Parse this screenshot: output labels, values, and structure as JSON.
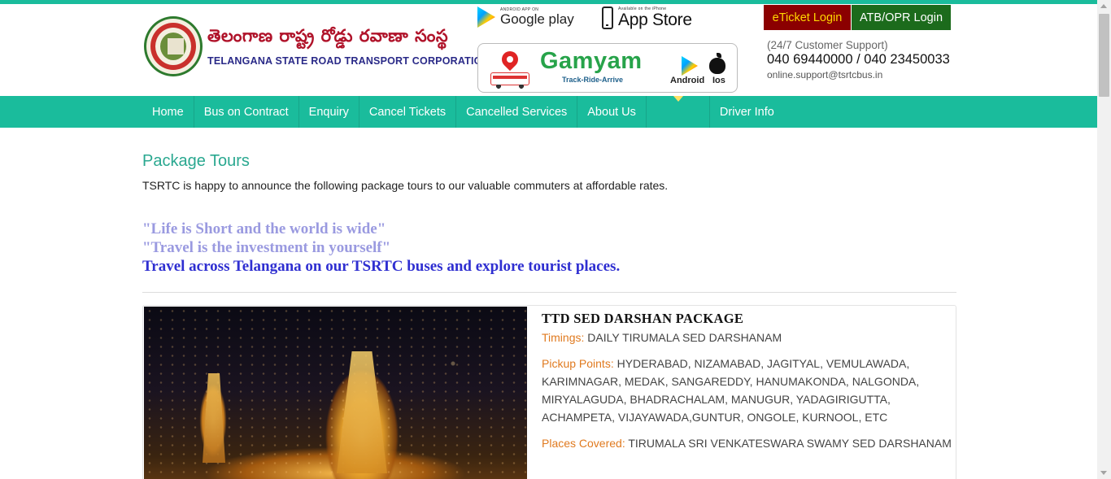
{
  "header": {
    "org_telugu": "తెలంగాణ రాష్ట్ర రోడ్డు రవాణా సంస్థ",
    "org_english": "TELANGANA STATE ROAD TRANSPORT CORPORATION",
    "google_play_small": "ANDROID APP ON",
    "google_play_label": "Google play",
    "app_store_small": "Available on the iPhone",
    "app_store_label": "App Store",
    "gamyam": {
      "title": "Gamyam",
      "tagline": "Track-Ride-Arrive",
      "android_label": "Android",
      "ios_label": "Ios"
    },
    "eticket_label": "eTicket Login",
    "atb_label": "ATB/OPR Login",
    "support": {
      "label": "(24/7 Customer Support)",
      "phones": "040 69440000 / 040 23450033",
      "email": "online.support@tsrtcbus.in"
    }
  },
  "nav": {
    "items": [
      {
        "label": "Home"
      },
      {
        "label": "Bus on Contract"
      },
      {
        "label": "Enquiry"
      },
      {
        "label": "Cancel Tickets"
      },
      {
        "label": "Cancelled Services"
      },
      {
        "label": "About Us"
      },
      {
        "label": "Driver Info"
      }
    ]
  },
  "main": {
    "title": "Package Tours",
    "intro": "TSRTC is happy to announce the following package tours to our valuable commuters at affordable rates.",
    "quote1": "\"Life is Short and the world is wide\"",
    "quote2": "\"Travel is the investment in yourself\"",
    "quote3": "Travel across Telangana on our TSRTC buses and explore tourist places."
  },
  "package": {
    "title": "TTD SED DARSHAN PACKAGE",
    "timings_label": "Timings:",
    "timings": "DAILY TIRUMALA SED DARSHANAM",
    "pickup_label": "Pickup Points:",
    "pickup": "HYDERABAD, NIZAMABAD, JAGITYAL, VEMULAWADA, KARIMNAGAR, MEDAK, SANGAREDDY, HANUMAKONDA, NALGONDA, MIRYALAGUDA, BHADRACHALAM, MANUGUR, YADAGIRIGUTTA, ACHAMPETA, VIJAYAWADA,GUNTUR, ONGOLE, KURNOOL, ETC",
    "places_label": "Places Covered:",
    "places": "TIRUMALA SRI VENKATESWARA SWAMY SED DARSHANAM"
  },
  "colors": {
    "accent": "#1abc9c",
    "eticket_bg": "#8b0000",
    "eticket_text": "#ffd700",
    "atb_bg": "#1c6b1c",
    "label_orange": "#e07a1f"
  }
}
